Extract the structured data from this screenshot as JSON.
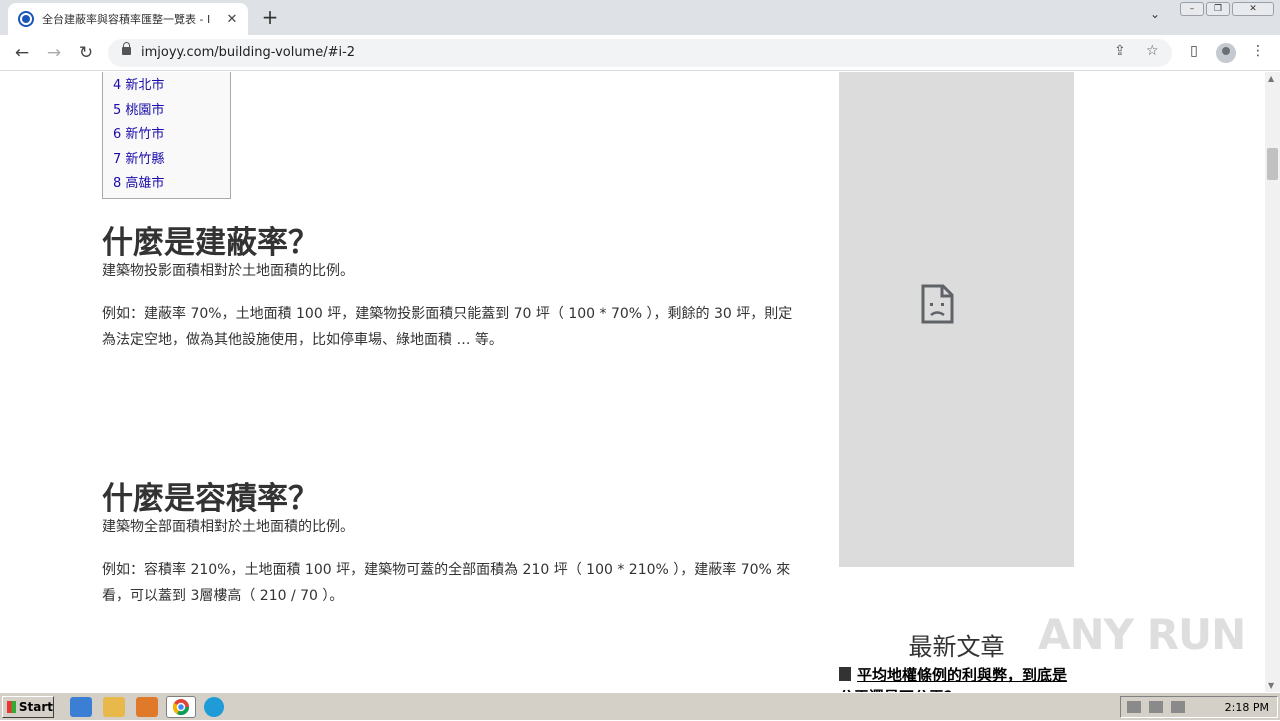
{
  "browser": {
    "tab_title": "全台建蔽率與容積率匯整一覽表 - Imjoyy",
    "new_tab_symbol": "+",
    "url": "imjoyy.com/building-volume/#i-2"
  },
  "toc": {
    "items": [
      "4 新北市",
      "5 桃園市",
      "6 新竹市",
      "7 新竹縣",
      "8 高雄市"
    ]
  },
  "article": {
    "section1": {
      "heading": "什麼是建蔽率？",
      "definition": "建築物投影面積相對於土地面積的比例。",
      "example": "例如：建蔽率 70%，土地面積 100 坪，建築物投影面積只能蓋到 70 坪（ 100 * 70% ），剩餘的 30 坪，則定為法定空地，做為其他設施使用，比如停車場、綠地面積 … 等。"
    },
    "section2": {
      "heading": "什麼是容積率？",
      "definition": "建築物全部面積相對於土地面積的比例。",
      "example": "例如：容積率 210%，土地面積 100 坪，建築物可蓋的全部面積為 210 坪（ 100 * 210% ），建蔽率 70% 來看，可以蓋到 3層樓高（ 210 / 70 ）。"
    }
  },
  "sidebar": {
    "latest_title": "最新文章",
    "latest_items": [
      "平均地權條例的利與弊，到底是公平還是不公平？"
    ]
  },
  "watermark": "ANY RUN",
  "taskbar": {
    "start_label": "Start",
    "clock": "2:18 PM"
  }
}
